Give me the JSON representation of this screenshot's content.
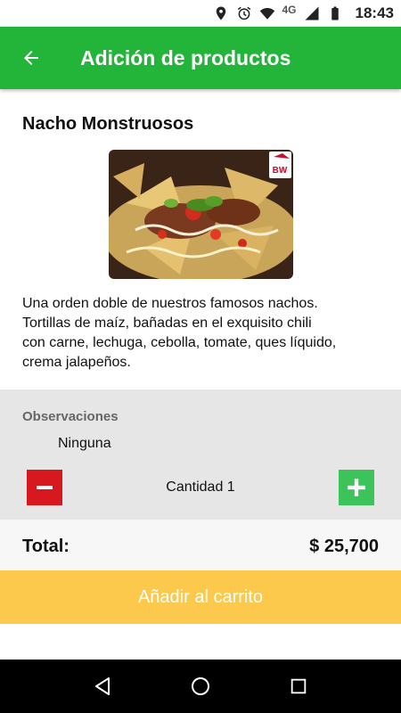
{
  "status_bar": {
    "network": "4G",
    "time": "18:43",
    "icons": [
      "location-icon",
      "alarm-icon",
      "wifi-icon",
      "signal-icon",
      "battery-icon"
    ]
  },
  "app_bar": {
    "title": "Adición de productos",
    "back_icon": "arrow-left-icon"
  },
  "product": {
    "name": "Nacho Monstruosos",
    "image_alt": "Nachos",
    "logo_text": "BW",
    "description": "Una orden doble de nuestros famosos nachos.\nTortillas de maíz, bañadas en el exquisito chili\ncon carne, lechuga, cebolla, tomate, ques líquido,\ncrema  jalapeños."
  },
  "options": {
    "observations_label": "Observaciones",
    "observations_value": "Ninguna",
    "quantity_text": "Cantidad 1",
    "quantity": 1
  },
  "total": {
    "label": "Total:",
    "value": "$ 25,700"
  },
  "actions": {
    "add_to_cart": "Añadir al carrito"
  },
  "colors": {
    "app_bar": "#23b53a",
    "minus_button": "#d7191f",
    "plus_button": "#3cc45a",
    "add_to_cart": "#fcc94d"
  }
}
